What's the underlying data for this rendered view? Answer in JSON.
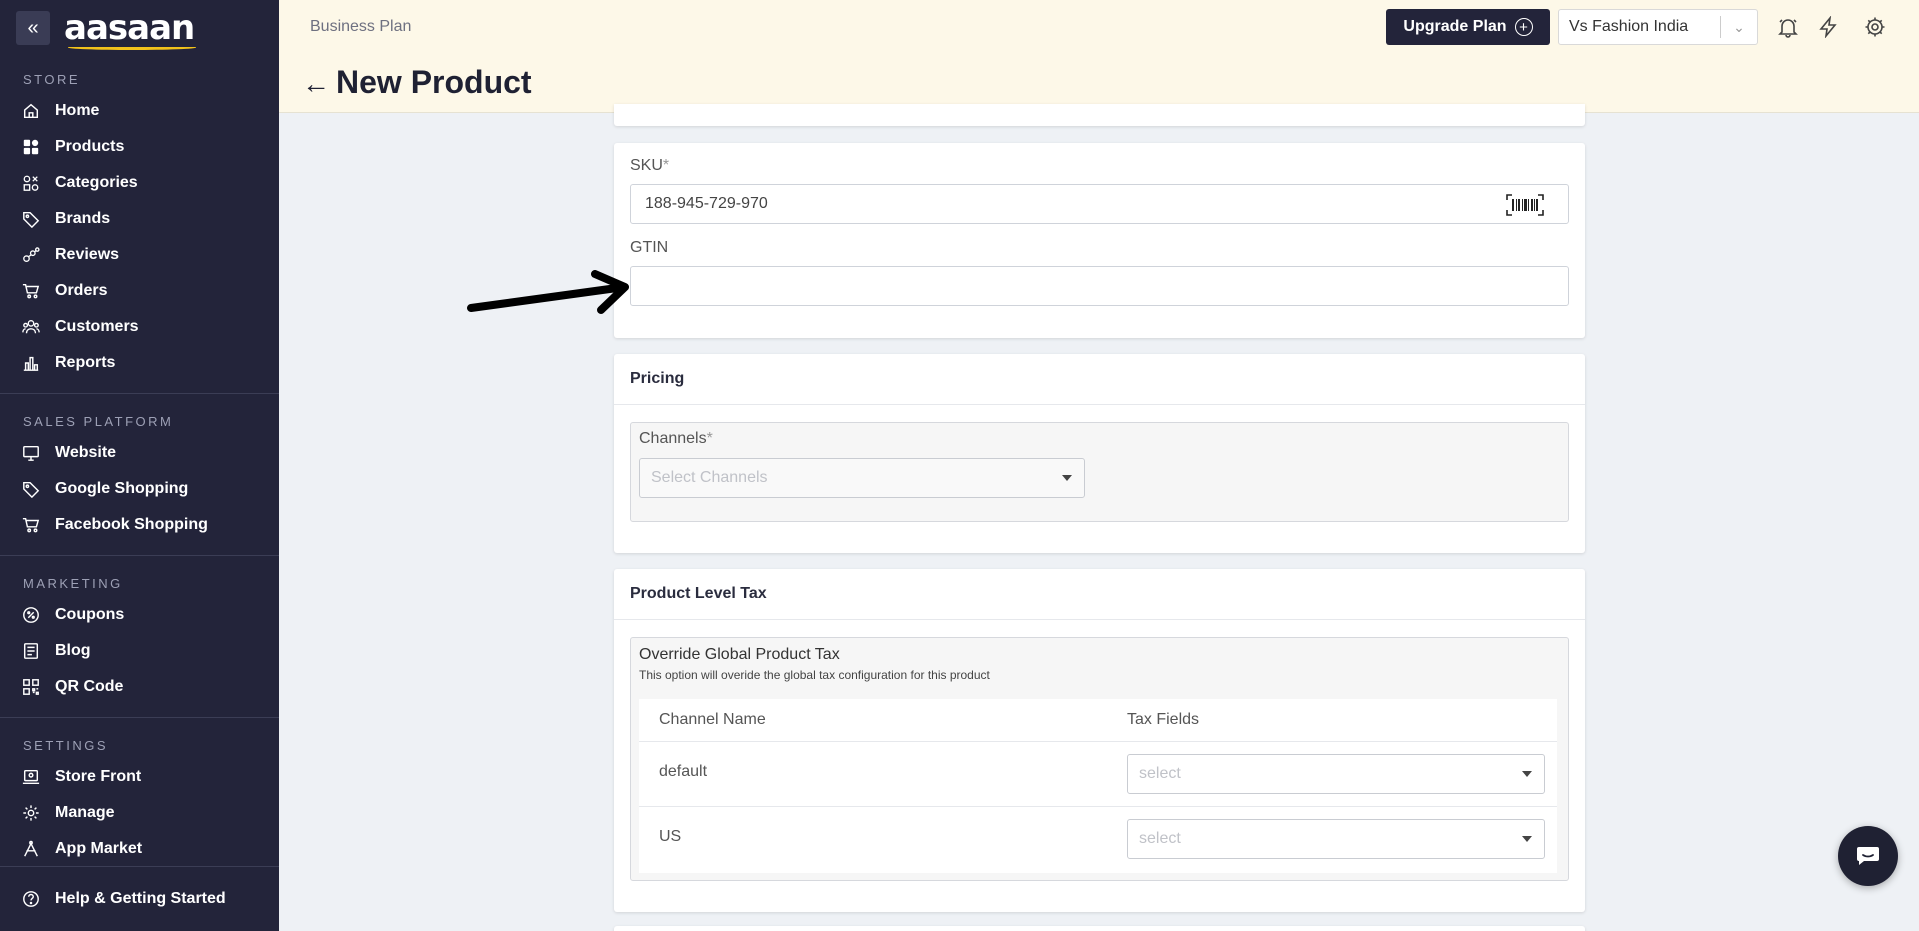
{
  "sidebar": {
    "logo": "aasaan",
    "sections": [
      {
        "title": "STORE",
        "items": [
          {
            "label": "Home",
            "icon": "home-icon"
          },
          {
            "label": "Products",
            "icon": "grid-icon"
          },
          {
            "label": "Categories",
            "icon": "categories-icon"
          },
          {
            "label": "Brands",
            "icon": "tag-icon"
          },
          {
            "label": "Reviews",
            "icon": "reviews-icon"
          },
          {
            "label": "Orders",
            "icon": "cart-icon"
          },
          {
            "label": "Customers",
            "icon": "users-icon"
          },
          {
            "label": "Reports",
            "icon": "bar-chart-icon"
          }
        ]
      },
      {
        "title": "SALES PLATFORM",
        "items": [
          {
            "label": "Website",
            "icon": "monitor-icon"
          },
          {
            "label": "Google Shopping",
            "icon": "tag-icon"
          },
          {
            "label": "Facebook Shopping",
            "icon": "cart-icon"
          }
        ]
      },
      {
        "title": "MARKETING",
        "items": [
          {
            "label": "Coupons",
            "icon": "coupon-icon"
          },
          {
            "label": "Blog",
            "icon": "blog-icon"
          },
          {
            "label": "QR Code",
            "icon": "qr-icon"
          }
        ]
      },
      {
        "title": "SETTINGS",
        "items": [
          {
            "label": "Store Front",
            "icon": "storefront-icon"
          },
          {
            "label": "Manage",
            "icon": "gear-icon"
          },
          {
            "label": "App Market",
            "icon": "app-market-icon"
          }
        ]
      }
    ],
    "help": "Help & Getting Started"
  },
  "header": {
    "plan": "Business Plan",
    "title": "New Product",
    "upgrade_label": "Upgrade Plan",
    "store_name": "Vs Fashion India"
  },
  "sku_card": {
    "sku_label": "SKU",
    "sku_value": "188-945-729-970",
    "gtin_label": "GTIN",
    "gtin_value": ""
  },
  "pricing_card": {
    "title": "Pricing",
    "channels_label": "Channels",
    "channels_placeholder": "Select Channels"
  },
  "tax_card": {
    "title": "Product Level Tax",
    "override_title": "Override Global Product Tax",
    "override_desc": "This option will overide the global tax configuration for this product",
    "col_channel": "Channel Name",
    "col_tax": "Tax Fields",
    "rows": [
      {
        "channel": "default",
        "placeholder": "select"
      },
      {
        "channel": "US",
        "placeholder": "select"
      }
    ]
  },
  "required_mark": "*",
  "colors": {
    "sidebar_bg": "#23243a",
    "header_bg": "#fdf8e8",
    "accent": "#f2c21b"
  }
}
